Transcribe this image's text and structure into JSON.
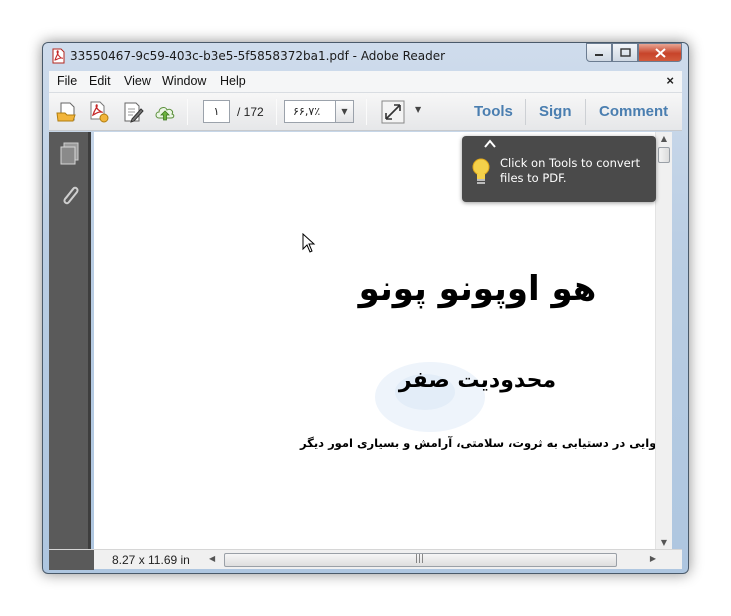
{
  "window": {
    "title": "33550467-9c59-403c-b3e5-5f5858372ba1.pdf - Adobe Reader"
  },
  "menu": {
    "items": [
      "File",
      "Edit",
      "View",
      "Window",
      "Help"
    ],
    "close_symbol": "×"
  },
  "toolbar": {
    "icons": [
      "open-file-icon",
      "create-pdf-icon",
      "edit-icon",
      "cloud-upload-icon",
      "fit-page-icon"
    ],
    "page_current": "۱",
    "page_total": "/ 172",
    "zoom": "۶۶,۷٪",
    "tools_label": "Tools",
    "sign_label": "Sign",
    "comment_label": "Comment"
  },
  "nav_panel": {
    "icons": [
      "pages-icon",
      "attachments-icon"
    ]
  },
  "document": {
    "heading": "هو اوپونو پونو",
    "subheading": "محدودیت صفر",
    "tagline": "روش پنهان بومیان هاوایی در دستیابی به ثروت، سلامتی، آرامش و بسیاری امور دیگر"
  },
  "tooltip": {
    "text": "Click on Tools to convert files to PDF."
  },
  "status": {
    "page_size": "8.27 x 11.69 in"
  }
}
